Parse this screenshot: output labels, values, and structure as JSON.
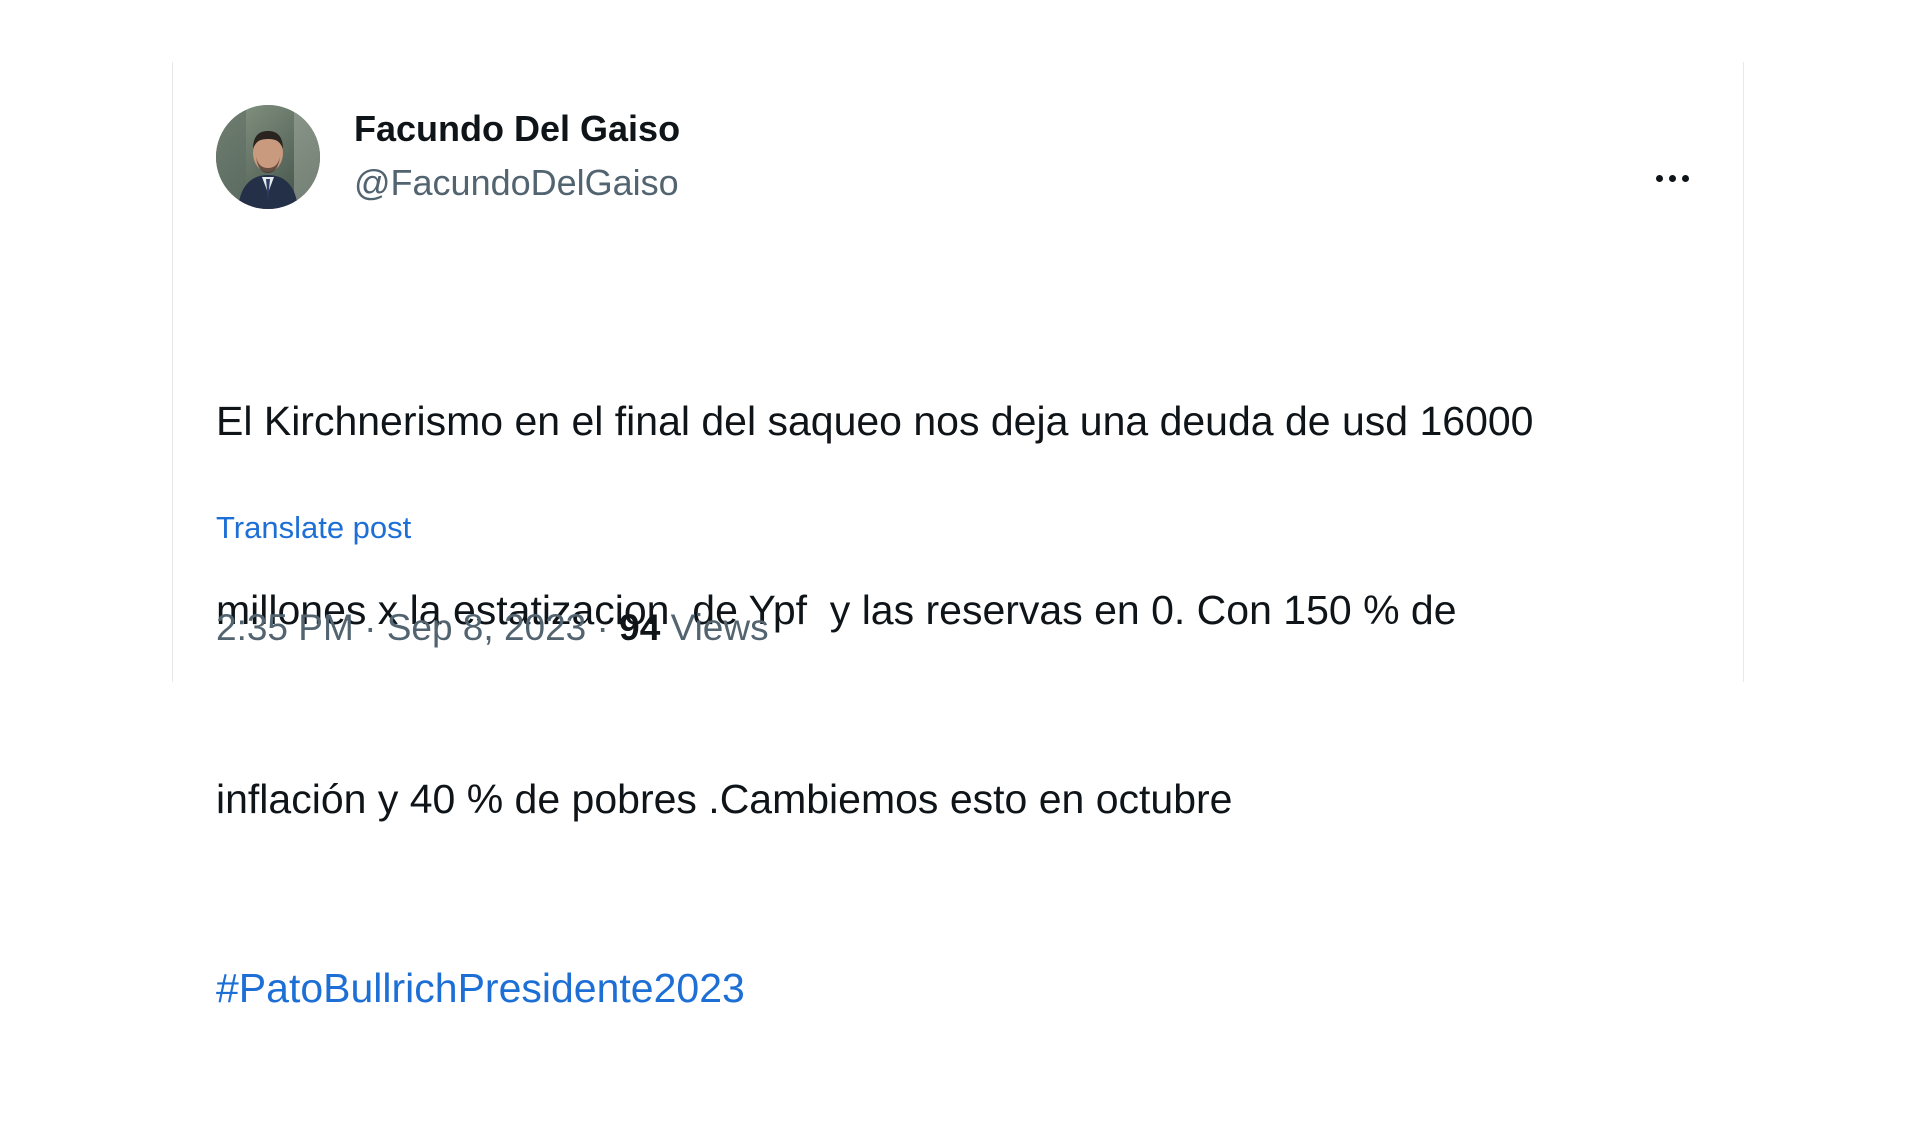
{
  "tweet": {
    "author": {
      "display_name": "Facundo Del Gaiso",
      "handle": "@FacundoDelGaiso",
      "avatar_icon": "profile-photo"
    },
    "more_icon": "ellipsis-icon",
    "text_lines": [
      "El Kirchnerismo en el final del saqueo nos deja una deuda de usd 16000",
      "millones x la estatizacion  de Ypf  y las reservas en 0. Con 150 % de",
      "inflación y 40 % de pobres .Cambiemos esto en octubre"
    ],
    "hashtag": "#PatoBullrichPresidente2023",
    "translate_label": "Translate post",
    "time": "2:35 PM",
    "separator": " · ",
    "date": "Sep 8, 2023",
    "views_count": "94",
    "views_label": "Views"
  },
  "colors": {
    "text": "#0f1419",
    "secondary_text": "#536471",
    "link": "#1d6fd6"
  }
}
